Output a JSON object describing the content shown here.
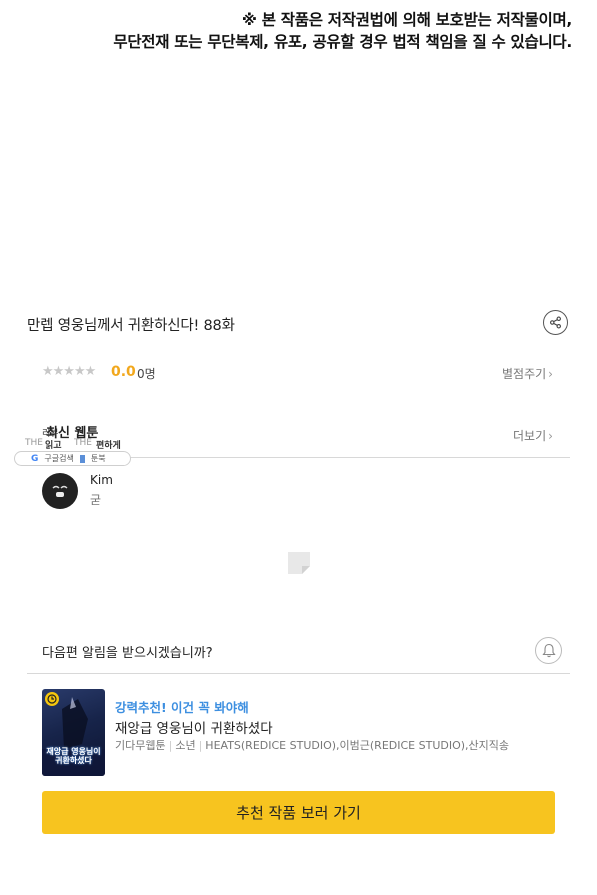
{
  "notice": {
    "line1": "※ 본 작품은 저작권법에 의해 보호받는 저작물이며,",
    "line2": "무단전재 또는 무단복제, 유포, 공유할 경우 법적 책임을 질 수 있습니다."
  },
  "episode": {
    "title": "만렙 영웅님께서 귀환하신다! 88화",
    "share_icon": "share-icon"
  },
  "rating": {
    "stars": "★★★★★",
    "score": "0.0",
    "count": "0명",
    "rate_label": "별점주기"
  },
  "latest": {
    "heading": "최신 웹툰",
    "more_label": "더보기"
  },
  "ad": {
    "text1": "리뷰",
    "text2": "읽고",
    "text3": "THE",
    "text4": "편하게",
    "pill_g": "구글검색",
    "pill_b": "툰북"
  },
  "comment": {
    "name": "Kim",
    "text": "굳"
  },
  "alarm": {
    "text": "다음편 알림을 받으시겠습니까?",
    "icon": "bell-icon"
  },
  "recommend": {
    "tag": "강력추천! 이건 꼭 봐야해",
    "title": "재앙급 영웅님이 귀환하셨다",
    "meta": [
      "기다무웹툰",
      "소년",
      "HEATS(REDICE STUDIO),이범근(REDICE STUDIO),산지직송"
    ],
    "thumb_text": "재앙급 영웅님이 귀환하셨다",
    "button_label": "추천 작품 보러 가기"
  },
  "colors": {
    "score": "#f2a81d",
    "recommend_tag": "#3d8fe0",
    "cta_bg": "#f7c41f"
  }
}
